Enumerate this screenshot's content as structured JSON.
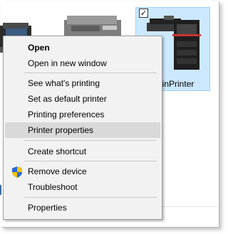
{
  "background": {
    "selected_tile_label": "ninPrinter",
    "selected_tile_checked": "✓"
  },
  "menu": {
    "items": [
      {
        "label": "Open",
        "bold": true
      },
      {
        "label": "Open in new window"
      },
      {
        "label": "See what's printing"
      },
      {
        "label": "Set as default printer"
      },
      {
        "label": "Printing preferences"
      },
      {
        "label": "Printer properties",
        "hover": true
      },
      {
        "label": "Create shortcut"
      },
      {
        "label": "Remove device",
        "icon": "uac-shield-icon"
      },
      {
        "label": "Troubleshoot"
      },
      {
        "label": "Properties"
      }
    ]
  },
  "colors": {
    "menu_bg": "#f2f2f2",
    "hover_bg": "#d9d9d9",
    "selection_bg": "#cce8ff",
    "selection_border": "#99d1ff",
    "shield_blue": "#2a6ad8",
    "shield_yellow": "#f5c400"
  }
}
